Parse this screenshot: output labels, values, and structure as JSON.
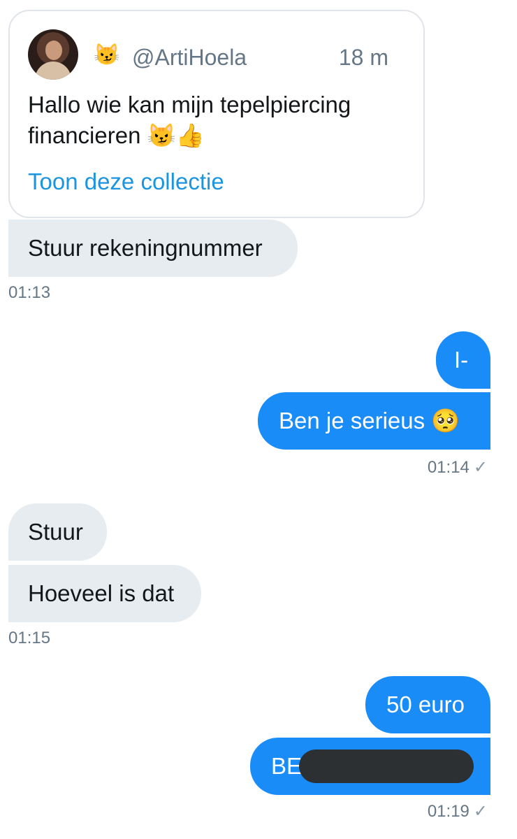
{
  "tweet_card": {
    "badge_emoji": "😼",
    "handle": "@ArtiHoela",
    "time_ago": "18 m",
    "text": "Hallo wie kan mijn tepelpiercing financieren 😼👍",
    "link": "Toon deze collectie"
  },
  "messages": [
    {
      "side": "in",
      "text": "Stuur rekeningnummer"
    },
    {
      "side": "out",
      "text": "I-"
    },
    {
      "side": "out",
      "text": "Ben je serieus 🥺"
    },
    {
      "side": "in",
      "text": "Stuur"
    },
    {
      "side": "in",
      "text": "Hoeveel is dat"
    },
    {
      "side": "out",
      "text": "50 euro"
    },
    {
      "side": "out",
      "text": "BE"
    }
  ],
  "timestamps": {
    "t1": "01:13",
    "t2": "01:14",
    "t3": "01:15",
    "t4": "01:19"
  },
  "icons": {
    "sent_check": "✓"
  },
  "colors": {
    "incoming_bubble": "#e6ecf0",
    "outgoing_bubble": "#1a8cf7",
    "link": "#1b95e0",
    "meta_text": "#657786"
  }
}
